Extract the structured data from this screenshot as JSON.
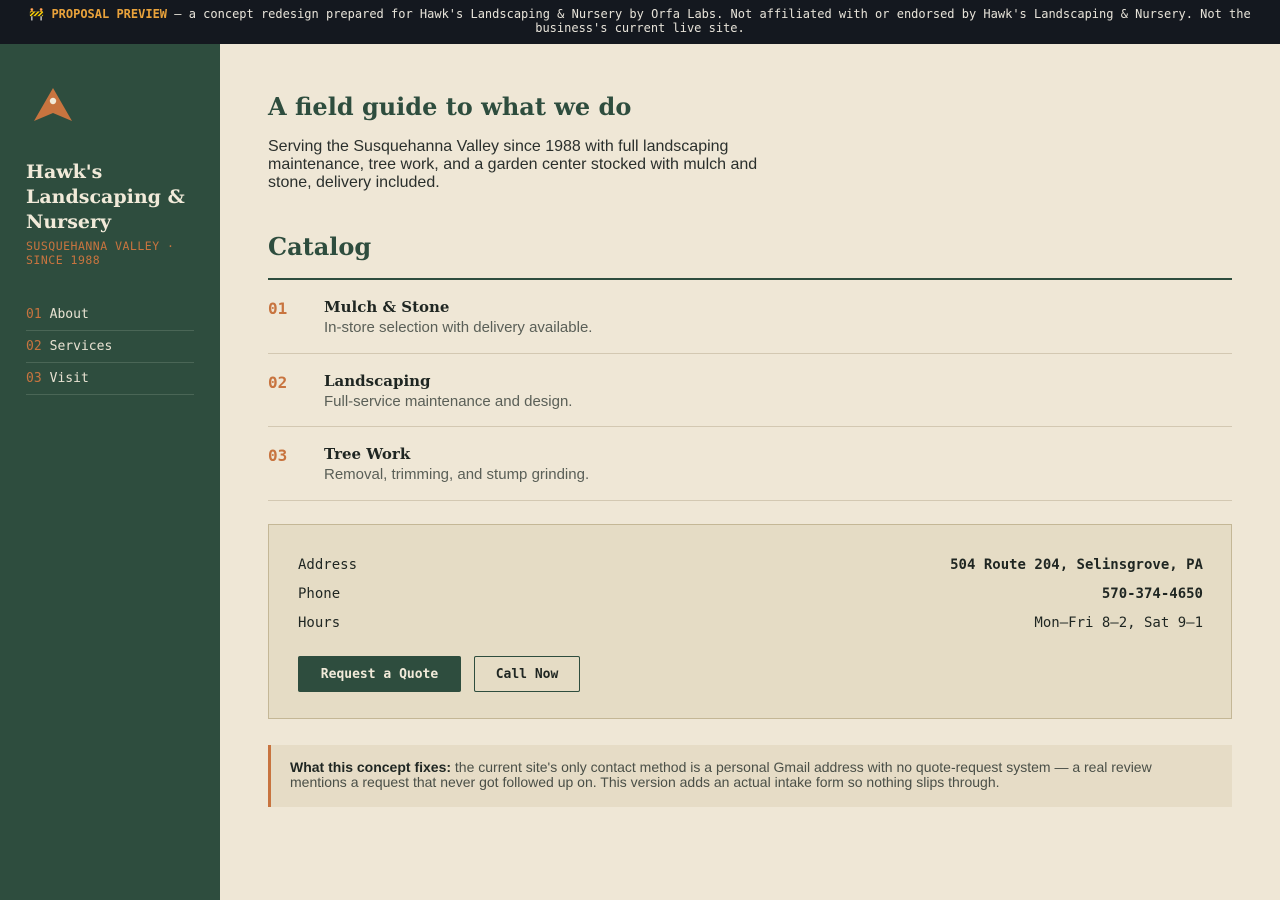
{
  "banner": {
    "icon": "construction-icon",
    "tag": "PROPOSAL PREVIEW",
    "text": "— a concept redesign prepared for Hawk's Landscaping & Nursery by Orfa Labs. Not affiliated with or endorsed by Hawk's Landscaping & Nursery. Not the business's current live site."
  },
  "sidebar": {
    "logo": "hawk-logo-icon",
    "brand_name": "Hawk's Landscaping & Nursery",
    "brand_tag": "SUSQUEHANNA VALLEY · SINCE 1988",
    "nav": [
      {
        "num": "01",
        "label": "About"
      },
      {
        "num": "02",
        "label": "Services"
      },
      {
        "num": "03",
        "label": "Visit"
      }
    ]
  },
  "main": {
    "title": "A field guide to what we do",
    "intro": "Serving the Susquehanna Valley since 1988 with full landscaping maintenance, tree work, and a garden center stocked with mulch and stone, delivery included.",
    "catalog_title": "Catalog",
    "catalog": [
      {
        "num": "01",
        "name": "Mulch & Stone",
        "desc": "In-store selection with delivery available."
      },
      {
        "num": "02",
        "name": "Landscaping",
        "desc": "Full-service maintenance and design."
      },
      {
        "num": "03",
        "name": "Tree Work",
        "desc": "Removal, trimming, and stump grinding."
      }
    ]
  },
  "contact": {
    "rows": [
      {
        "label": "Address",
        "value": "504 Route 204, Selinsgrove, PA"
      },
      {
        "label": "Phone",
        "value": "570-374-4650"
      },
      {
        "label": "Hours",
        "value": "Mon–Fri 8–2, Sat 9–1"
      }
    ],
    "primary_button": "Request a Quote",
    "secondary_button": "Call Now"
  },
  "note": {
    "lead": "What this concept fixes:",
    "text": "the current site's only contact method is a personal Gmail address with no quote-request system — a real review mentions a request that never got followed up on. This version adds an actual intake form so nothing slips through."
  },
  "colors": {
    "sidebar": "#2e4d3e",
    "accent": "#c8743f",
    "page_bg": "#efe7d6",
    "banner_bg": "#14181f",
    "banner_tag": "#e9a23b"
  }
}
